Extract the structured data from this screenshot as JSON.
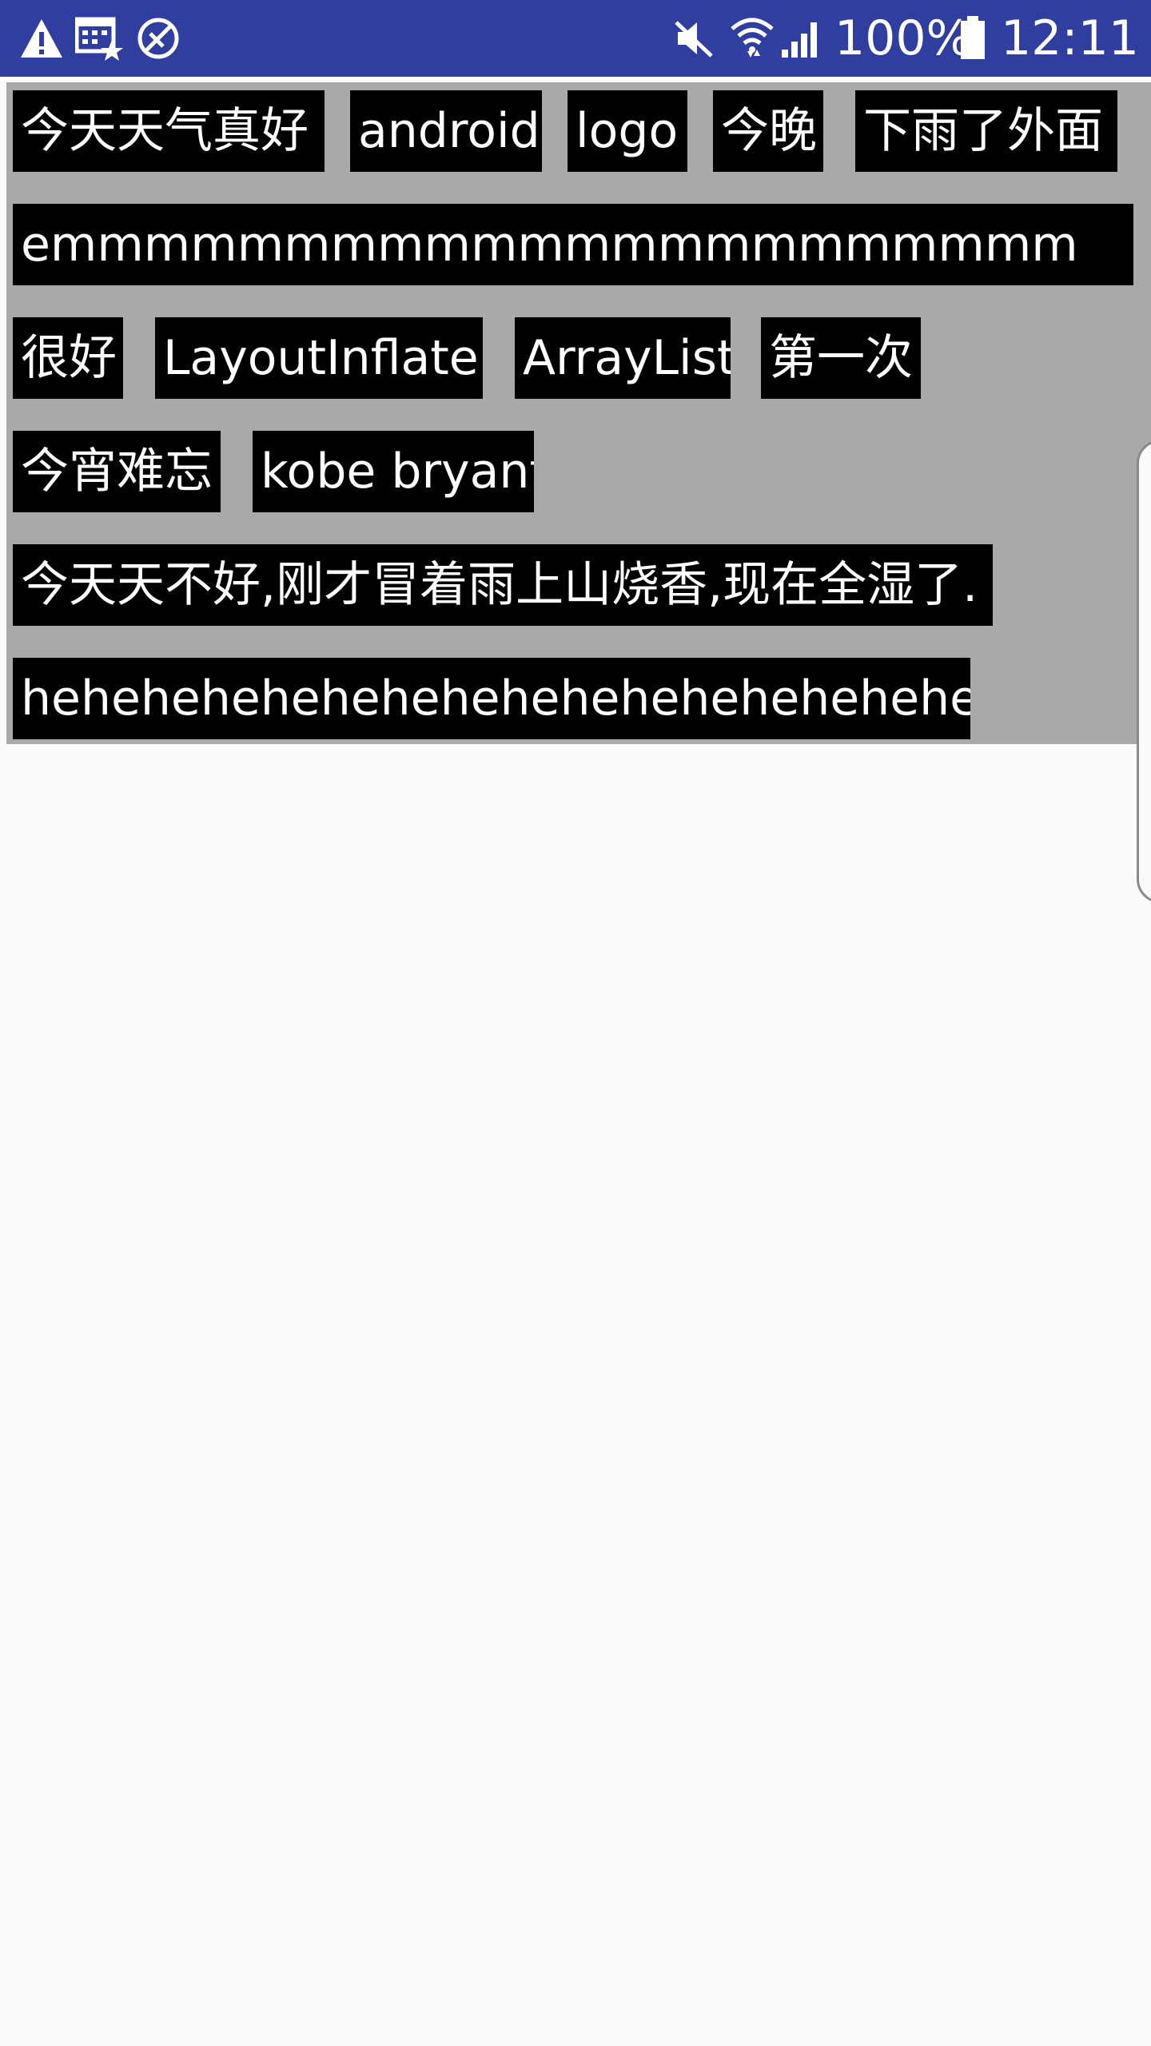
{
  "status_bar": {
    "background": "#303f9f",
    "left_icons": [
      "warning-icon",
      "calendar-star-icon",
      "blocked-icon"
    ],
    "right_icons": [
      "mute-icon",
      "wifi-icon",
      "signal-icon",
      "battery-icon"
    ],
    "battery": "100%",
    "time": "12:11"
  },
  "tag_flow": {
    "background": "#a9a9a9",
    "tag_background": "#000000",
    "tag_text_color": "#ffffff",
    "tags": [
      "今天天气真好",
      "android",
      "logo",
      "今晚",
      "下雨了外面",
      "emmmmmmmmmmmmmmmmmmmmmm",
      "很好",
      "LayoutInflater",
      "ArrayList",
      "第一次",
      "今宵难忘",
      "kobe bryant",
      "今天天不好,刚才冒着雨上山烧香,现在全湿了.",
      "hehehehehehehehehehehehehehehehehe"
    ]
  }
}
